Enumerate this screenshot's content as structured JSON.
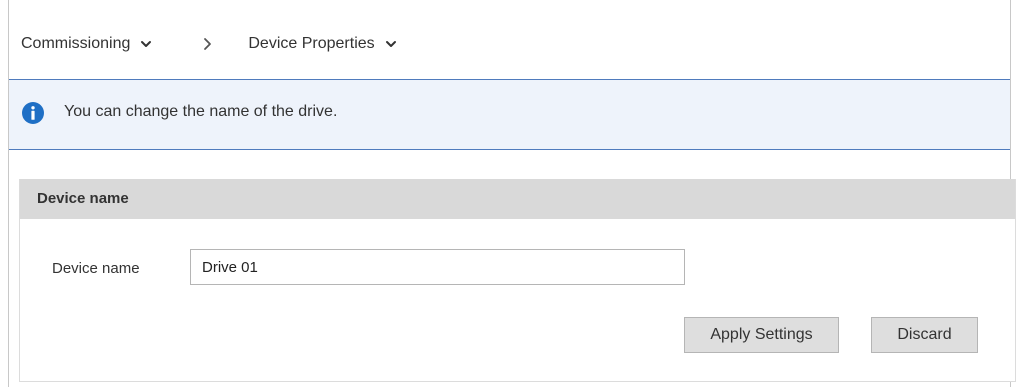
{
  "breadcrumb": {
    "items": [
      {
        "label": "Commissioning"
      },
      {
        "label": "Device Properties"
      }
    ]
  },
  "info": {
    "message": "You can change the name of the drive.",
    "icon": "info-icon",
    "accent": "#1f6fc5"
  },
  "section": {
    "title": "Device name",
    "field": {
      "label": "Device name",
      "value": "Drive 01"
    },
    "buttons": {
      "apply": "Apply Settings",
      "discard": "Discard"
    }
  },
  "colors": {
    "info_background": "#eef3fb",
    "info_border": "#4f7bbd",
    "section_header": "#d9d9d9",
    "button_background": "#dedede"
  }
}
